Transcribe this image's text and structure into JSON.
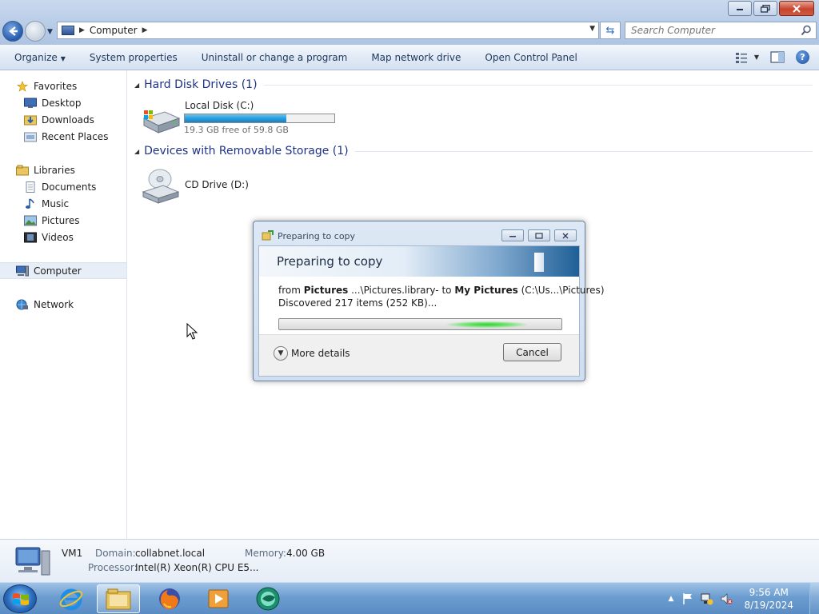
{
  "window": {
    "address": {
      "crumbs": [
        "Computer"
      ]
    },
    "search": {
      "placeholder": "Search Computer"
    }
  },
  "toolbar": {
    "organize": "Organize",
    "system_properties": "System properties",
    "uninstall": "Uninstall or change a program",
    "map_drive": "Map network drive",
    "control_panel": "Open Control Panel"
  },
  "sidebar": {
    "favorites": "Favorites",
    "desktop": "Desktop",
    "downloads": "Downloads",
    "recent": "Recent Places",
    "libraries": "Libraries",
    "documents": "Documents",
    "music": "Music",
    "pictures": "Pictures",
    "videos": "Videos",
    "computer": "Computer",
    "network": "Network"
  },
  "content": {
    "hdd_group": "Hard Disk Drives (1)",
    "removable_group": "Devices with Removable Storage (1)",
    "local_disk": {
      "name": "Local Disk (C:)",
      "free": "19.3 GB free of 59.8 GB",
      "used_fraction": 0.677
    },
    "cd_drive": {
      "name": "CD Drive (D:)"
    }
  },
  "dialog": {
    "title": "Preparing to copy",
    "header": "Preparing to copy",
    "from_prefix": "from",
    "from_name": "Pictures",
    "from_path": "...\\Pictures.library- to",
    "to_name": "My Pictures",
    "to_path": "(C:\\Us...\\Pictures)",
    "discovered": "Discovered 217 items (252 KB)...",
    "more_details": "More details",
    "cancel": "Cancel"
  },
  "details": {
    "name": "VM1",
    "domain_label": "Domain:",
    "domain": "collabnet.local",
    "memory_label": "Memory:",
    "memory": "4.00 GB",
    "processor_label": "Processor:",
    "processor": "Intel(R) Xeon(R) CPU E5..."
  },
  "taskbar": {
    "time": "9:56 AM",
    "date": "8/19/2024"
  }
}
